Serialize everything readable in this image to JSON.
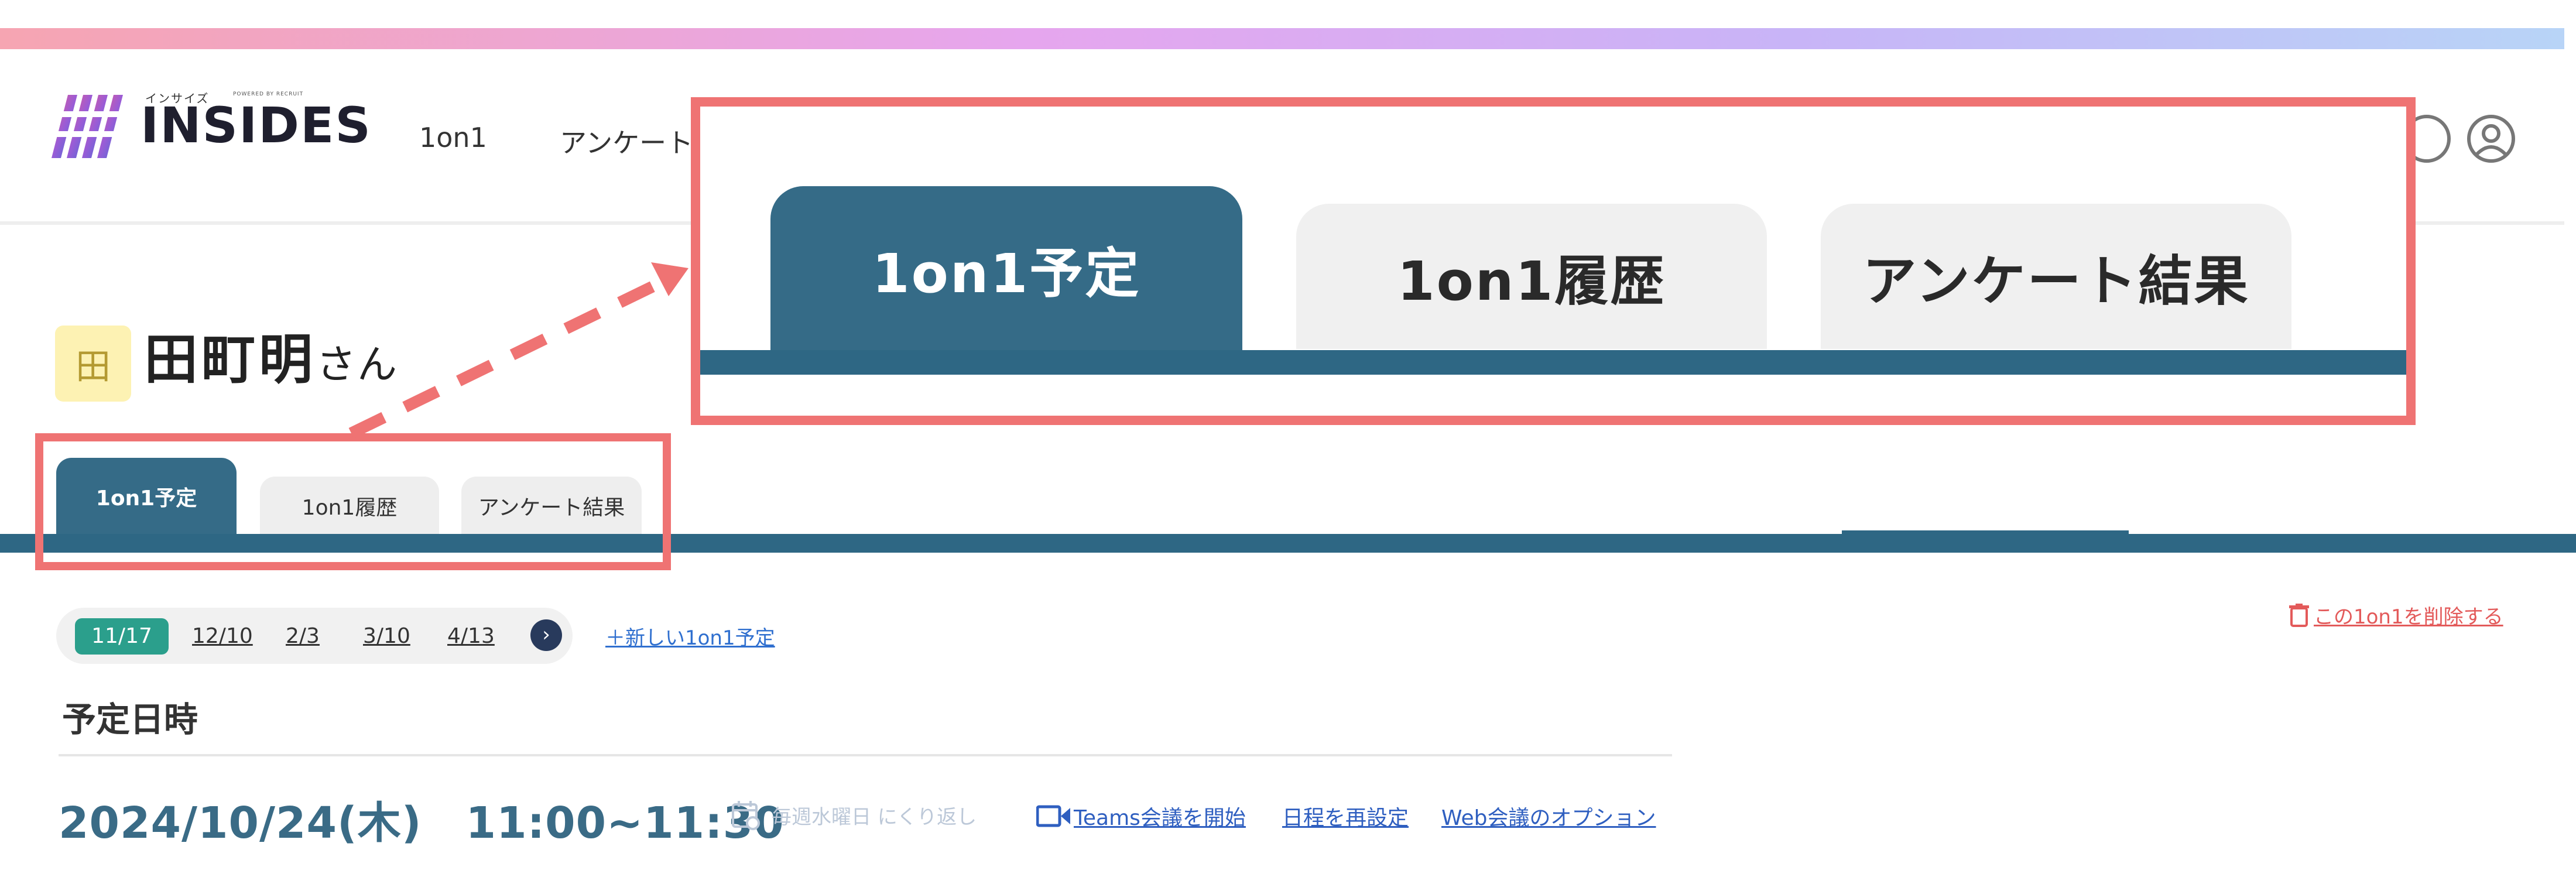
{
  "app": {
    "logo_kana": "インサイズ",
    "logo_sub": "POWERED BY RECRUIT",
    "logo_text": "INSIDES"
  },
  "nav": {
    "items": [
      {
        "label": "1on1"
      },
      {
        "label": "アンケート"
      }
    ],
    "icons": [
      "help-icon",
      "account-icon"
    ]
  },
  "user": {
    "badge": "田",
    "name": "田町明",
    "suffix": "さん"
  },
  "tabs": [
    {
      "label": "1on1予定",
      "active": true
    },
    {
      "label": "1on1履歴",
      "active": false
    },
    {
      "label": "アンケート結果",
      "active": false
    }
  ],
  "schedule": {
    "dates": [
      "11/17",
      "12/10",
      "2/3",
      "3/10",
      "4/13"
    ],
    "active_date": "11/17",
    "new_link": "＋新しい1on1予定",
    "delete_link": "この1on1を削除する",
    "section_title": "予定日時",
    "datetime": "2024/10/24(木)　11:00~11:30",
    "recurrence": "毎週水曜日 にくり返し",
    "actions": {
      "teams": "Teams会議を開始",
      "reschedule": "日程を再設定",
      "web_options": "Web会議のオプション"
    }
  },
  "colors": {
    "primary": "#356b87",
    "tab_bar": "#2e6784",
    "highlight": "#ef7373",
    "active_date": "#2b9f8c",
    "link": "#2f6fcf",
    "delete": "#e35a5a"
  }
}
